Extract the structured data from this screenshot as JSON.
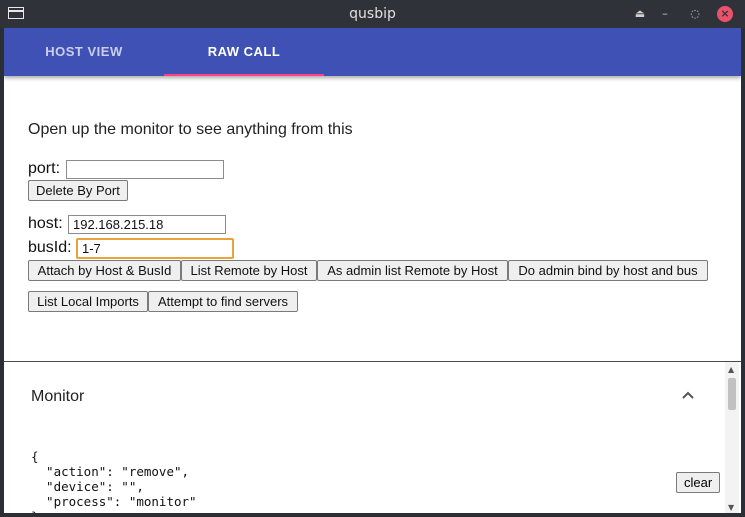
{
  "window": {
    "title": "qusbip"
  },
  "tabs": [
    {
      "label": "HOST VIEW",
      "active": false
    },
    {
      "label": "RAW CALL",
      "active": true
    }
  ],
  "raw_call": {
    "intro": "Open up the monitor to see anything from this",
    "port_label": "port:",
    "port_value": "",
    "delete_by_port": "Delete By Port",
    "host_label": "host:",
    "host_value": "192.168.215.18",
    "busid_label": "busId:",
    "busid_value": "1-7",
    "buttons_row1": [
      "Attach by Host & BusId",
      "List Remote by Host",
      "As admin list Remote by Host",
      "Do admin bind by host and bus"
    ],
    "buttons_row2": [
      "List Local Imports",
      "Attempt to find servers"
    ]
  },
  "monitor": {
    "title": "Monitor",
    "log": "{\n  \"action\": \"remove\",\n  \"device\": \"\",\n  \"process\": \"monitor\"\n}",
    "clear_label": "clear"
  },
  "colors": {
    "tab_bar": "#3f51b5",
    "tab_indicator": "#ff4081",
    "focus_ring": "#e8a33a"
  },
  "icons": [
    "window-app-icon",
    "eject-icon",
    "minimize-icon",
    "restore-icon",
    "close-icon",
    "chevron-up-icon"
  ]
}
